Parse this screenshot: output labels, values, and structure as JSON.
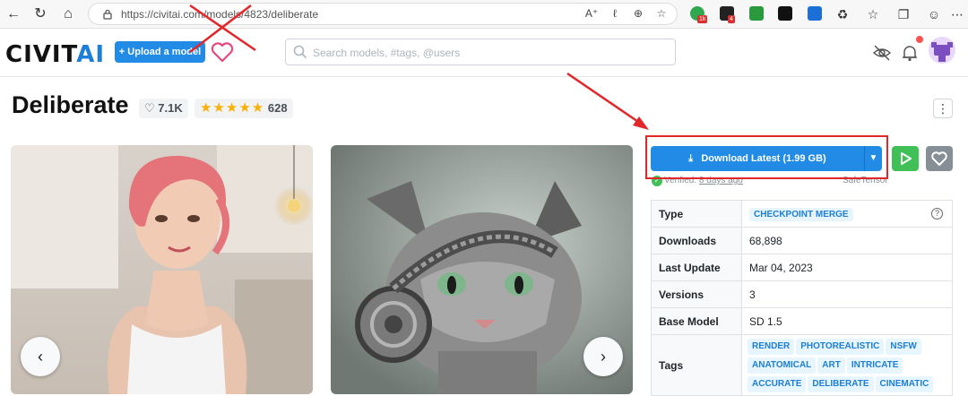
{
  "browser": {
    "url": "https://civitai.com/models/4823/deliberate",
    "ext_badges": [
      "1k",
      "4"
    ]
  },
  "header": {
    "logo_left": "CIVIT",
    "logo_right": "AI",
    "upload_label": "+ Upload a model",
    "search_placeholder": "Search models, #tags, @users"
  },
  "model": {
    "title": "Deliberate",
    "likes": "7.1K",
    "stars": "★★★★★",
    "rating_count": "628"
  },
  "download": {
    "label": "Download Latest (1.99 GB)",
    "verified_prefix": "Verified:",
    "verified_when": "8 days ago",
    "format": "SafeTensor"
  },
  "details": {
    "type_label": "Type",
    "type_value": "CHECKPOINT MERGE",
    "downloads_label": "Downloads",
    "downloads_value": "68,898",
    "last_update_label": "Last Update",
    "last_update_value": "Mar 04, 2023",
    "versions_label": "Versions",
    "versions_value": "3",
    "base_model_label": "Base Model",
    "base_model_value": "SD 1.5",
    "tags_label": "Tags",
    "tags": [
      "RENDER",
      "PHOTOREALISTIC",
      "NSFW",
      "ANATOMICAL",
      "ART",
      "INTRICATE",
      "ACCURATE",
      "DELIBERATE",
      "CINEMATIC"
    ]
  },
  "colors": {
    "accent": "#228be6",
    "play": "#40c057",
    "annotation": "#e3262a"
  }
}
